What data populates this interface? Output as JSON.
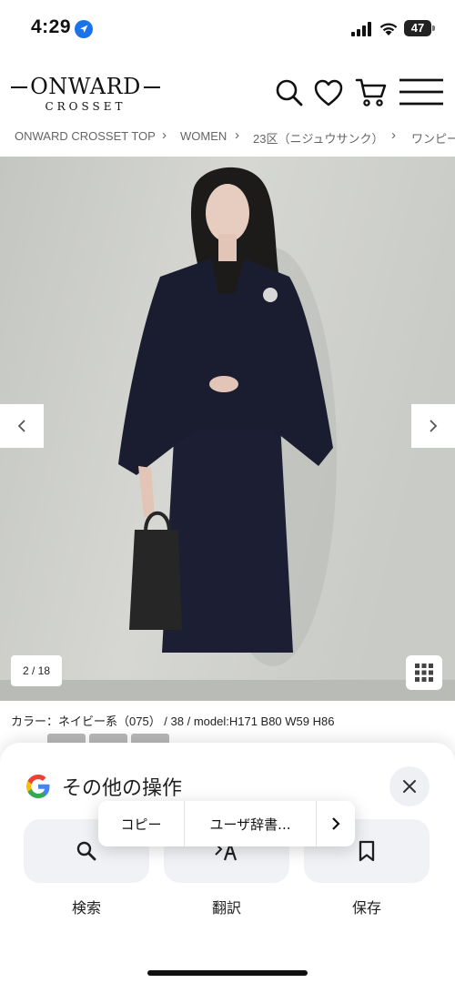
{
  "status_bar": {
    "time": "4:29",
    "battery": "47"
  },
  "header": {
    "logo_main": "ONWARD",
    "logo_sub": "CROSSET",
    "icons": [
      "search-icon",
      "heart-icon",
      "cart-icon",
      "menu-icon"
    ]
  },
  "breadcrumb": {
    "items": [
      "ONWARD CROSSET TOP",
      "WOMEN",
      "23区（ニジュウサンク）",
      "ワンピー"
    ]
  },
  "gallery": {
    "counter": "2 / 18"
  },
  "product": {
    "info_line": "カラー：ネイビー系（075）  /  38  /  model:H171 B80 W59 H86"
  },
  "sheet": {
    "title": "その他の操作",
    "actions": [
      {
        "label": "検索",
        "icon": "search-icon"
      },
      {
        "label": "翻訳",
        "icon": "translate-icon"
      },
      {
        "label": "保存",
        "icon": "bookmark-icon"
      }
    ]
  },
  "popover": {
    "items": [
      "コピー",
      "ユーザ辞書..."
    ],
    "more_icon": "chevron-right-icon"
  },
  "colors": {
    "google_blue": "#4285F4",
    "google_red": "#EA4335",
    "google_yellow": "#FBBC05",
    "google_green": "#34A853",
    "navy_dress": "#1c1f33"
  }
}
